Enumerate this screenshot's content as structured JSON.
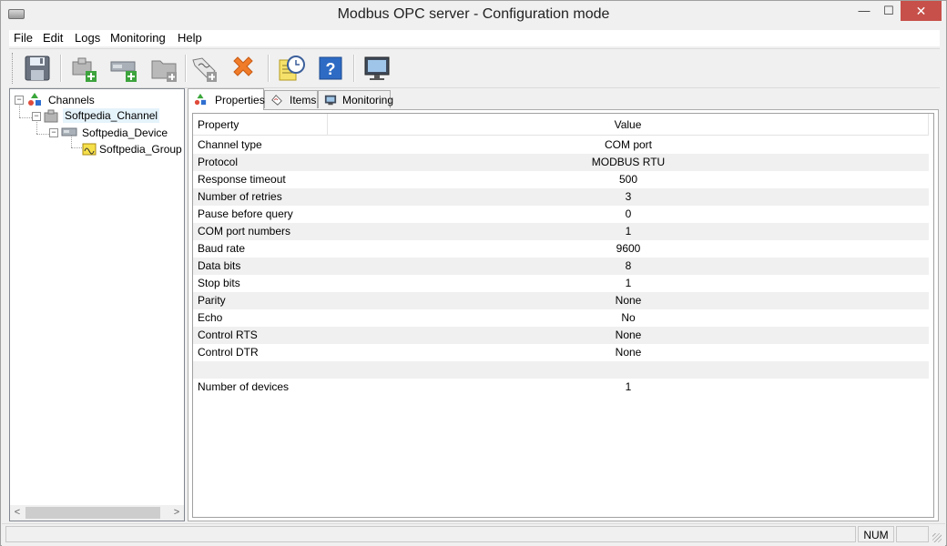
{
  "window": {
    "title": "Modbus OPC server - Configuration mode",
    "controls": {
      "minimize": "—",
      "maximize": "☐",
      "close": "✕"
    }
  },
  "menu": {
    "items": [
      "File",
      "Edit",
      "Logs",
      "Monitoring",
      "Help"
    ]
  },
  "toolbar": {
    "buttons": [
      {
        "name": "save-icon"
      },
      {
        "name": "add-channel-icon"
      },
      {
        "name": "add-device-icon"
      },
      {
        "name": "add-group-icon"
      },
      {
        "name": "add-item-icon"
      },
      {
        "name": "delete-icon"
      },
      {
        "name": "options-clock-icon"
      },
      {
        "name": "help-icon"
      },
      {
        "name": "monitor-icon"
      }
    ]
  },
  "tree": {
    "nodes": [
      {
        "label": "Channels",
        "expander": "−",
        "icon": "channels-icon"
      },
      {
        "label": "Softpedia_Channel",
        "expander": "−",
        "icon": "channel-icon"
      },
      {
        "label": "Softpedia_Device",
        "expander": "−",
        "icon": "device-icon"
      },
      {
        "label": "Softpedia_Group",
        "icon": "group-icon"
      }
    ],
    "scroll_left": "<",
    "scroll_right": ">"
  },
  "tabs": [
    {
      "label": "Properties",
      "icon": "properties-icon",
      "active": true
    },
    {
      "label": "Items",
      "icon": "items-icon",
      "active": false
    },
    {
      "label": "Monitoring",
      "icon": "monitoring-icon",
      "active": false
    }
  ],
  "grid": {
    "columns": [
      "Property",
      "Value"
    ],
    "rows": [
      {
        "property": "Channel type",
        "value": "COM port"
      },
      {
        "property": "Protocol",
        "value": "MODBUS RTU"
      },
      {
        "property": "Response timeout",
        "value": "500"
      },
      {
        "property": "Number of retries",
        "value": "3"
      },
      {
        "property": "Pause before query",
        "value": "0"
      },
      {
        "property": "COM port numbers",
        "value": "1"
      },
      {
        "property": "Baud rate",
        "value": "9600"
      },
      {
        "property": "Data bits",
        "value": "8"
      },
      {
        "property": "Stop bits",
        "value": "1"
      },
      {
        "property": "Parity",
        "value": "None"
      },
      {
        "property": "Echo",
        "value": "No"
      },
      {
        "property": "Control RTS",
        "value": "None"
      },
      {
        "property": "Control DTR",
        "value": "None"
      },
      {
        "property": "",
        "value": ""
      },
      {
        "property": "Number of devices",
        "value": "1"
      }
    ]
  },
  "status": {
    "num": "NUM"
  },
  "colors": {
    "close_button": "#c7504a",
    "alt_row": "#f0f0f0",
    "selection_highlight": "#e5f3fb"
  }
}
